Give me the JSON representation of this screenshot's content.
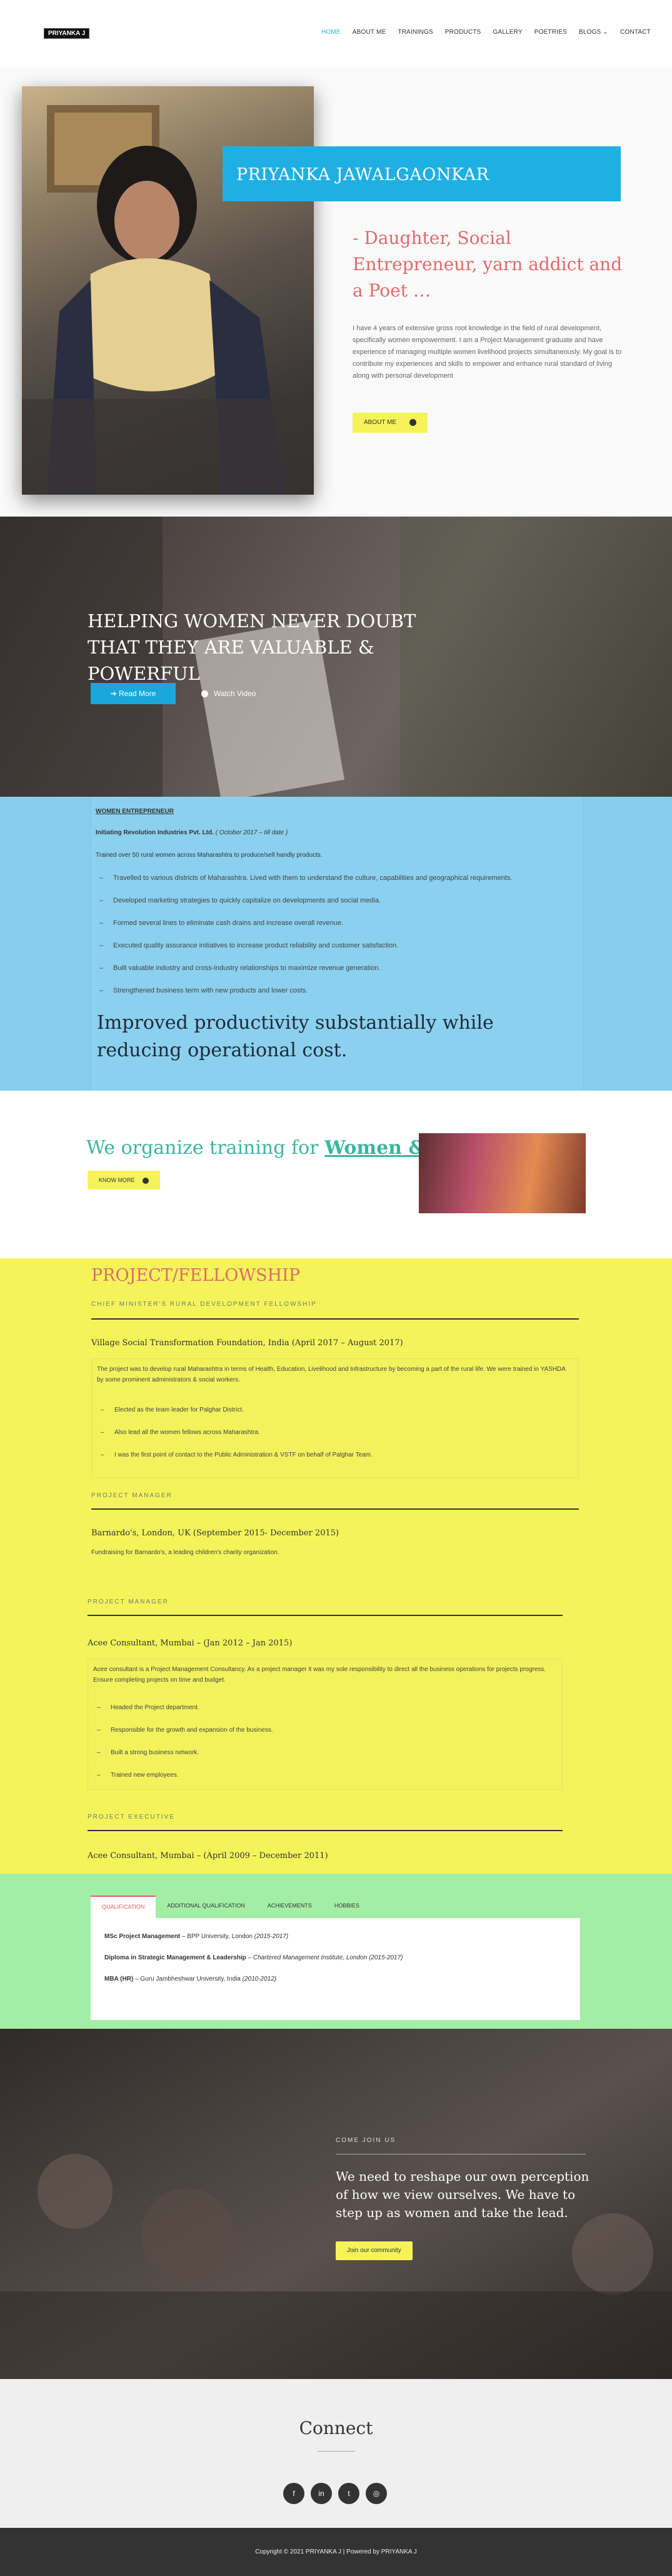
{
  "header": {
    "logo": "PRIYANKA J",
    "nav": [
      "HOME",
      "ABOUT ME",
      "TRAININGS",
      "PRODUCTS",
      "GALLERY",
      "POETRIES",
      "BLOGS",
      "CONTACT"
    ],
    "blogs_caret": "⌄"
  },
  "hero": {
    "name": "PRIYANKA JAWALGAONKAR",
    "tagline": "- Daughter, Social Entrepreneur, yarn addict and a Poet …",
    "bio": "I have 4 years of extensive gross root knowledge in the field of rural development, specifically women empowerment. I am a Project Management graduate and have experience of managing multiple women livelihood projects simultaneously. My goal is to contribute my experiences and skills to empower and enhance rural standard of living along with personal development",
    "about_btn": "ABOUT ME"
  },
  "women": {
    "headline": "HELPING WOMEN NEVER DOUBT THAT THEY ARE VALUABLE & POWERFUL",
    "read_more": "Read More",
    "watch_video": "Watch Video"
  },
  "entrepreneur": {
    "label": "WOMEN ENTREPRENEUR",
    "company": "Initiating Revolution Industries Pvt. Ltd.",
    "period": "( October 2017 – till date )",
    "intro": "Trained over 50 rural women across Maharashtra to produce/sell handly products.",
    "items": [
      "Travelled to various districts of Maharashtra. Lived with them to understand the culture, capabilities and geographical requirements.",
      "Developed marketing strategies to quickly capitalize on developments and social media.",
      "Formed several lines to eliminate cash drains and increase overall revenue.",
      "Executed quality assurance initiatives to increase product reliability and customer satisfaction.",
      "Built valuable industry and cross-industry relationships to maximize revenue generation.",
      "Strengthened business term with new products and lower costs."
    ],
    "statement": "Improved productivity substantially while reducing operational cost."
  },
  "training": {
    "lead": "We organize training for ",
    "highlight": "Women & Girls",
    "btn": "KNOW MORE"
  },
  "project": {
    "title": "PROJECT/FELLOWSHIP",
    "f1": {
      "label": "CHIEF MINISTER'S RURAL DEVELOPMENT FELLOWSHIP",
      "org": "Village Social Transformation Foundation, India (April 2017 – August 2017)",
      "desc": "The project was to develop rural Maharashtra in terms of Health, Education, Livelihood and Infrastructure by becoming a part of the rural life. We were trained in YASHDA by some prominent administrators & social workers.",
      "items": [
        "Elected as the team leader for Palghar District.",
        "Also lead all the women fellows across Maharashtra.",
        "I was the first point of contact to the Public Administration & VSTF on behalf of Palghar Team."
      ]
    },
    "f2": {
      "label": "PROJECT MANAGER",
      "org": "Barnardo's, London, UK (September 2015- December 2015)",
      "desc": "Fundraising for Barnardo's, a leading children's charity organization."
    },
    "f3": {
      "label": "PROJECT MANAGER",
      "org": "Acee Consultant, Mumbai – (Jan 2012 – Jan 2015)",
      "desc": "Acee consultant is a Project Management Consultancy. As a project manager it was my sole responsibility to direct all the business operations for projects progress. Ensure completing projects on time and budget.",
      "items": [
        "Headed the Project department.",
        "Responsible for the growth and expansion of the business.",
        "Built a strong business network.",
        "Trained new employees."
      ]
    },
    "f4": {
      "label": "PROJECT EXECUTIVE",
      "org": "Acee Consultant, Mumbai – (April 2009 – December 2011)"
    }
  },
  "qualification": {
    "tabs": [
      "QUALIFICATION",
      "ADDITIONAL QUALIFICATION",
      "ACHIEVEMENTS",
      "HOBBIES"
    ],
    "rows": [
      {
        "degree": "MSc Project Management",
        "sep": " – ",
        "place": "BPP University, London",
        "years": " (2015-2017)"
      },
      {
        "degree": "Diploma in Strategic Management & Leadership",
        "sep": " – ",
        "place": "Chartered Management Institute, London",
        "years": " (2015-2017)"
      },
      {
        "degree": "MBA (HR)",
        "sep": " – ",
        "place": "Guru Jambheshwar University, India",
        "years": " (2010-2012)"
      }
    ]
  },
  "join": {
    "label": "COME JOIN US",
    "quote": "We need to reshape our own perception of how we view ourselves. We have to step up as women and take the lead.",
    "btn": "Join our community"
  },
  "connect": {
    "title": "Connect",
    "icons": [
      "facebook-icon",
      "linkedin-icon",
      "twitter-icon",
      "instagram-icon"
    ],
    "glyphs": [
      "f",
      "in",
      "t",
      "◎"
    ]
  },
  "footer": "Copyright © 2021 PRIYANKA J | Powered by PRIYANKA J",
  "colors": {
    "accent": "#1fb0e3",
    "coral": "#e06a6a",
    "teal": "#3cb5a0",
    "yellow": "#f4f45a",
    "sky": "#87ceed",
    "mint": "#a3eea6"
  }
}
